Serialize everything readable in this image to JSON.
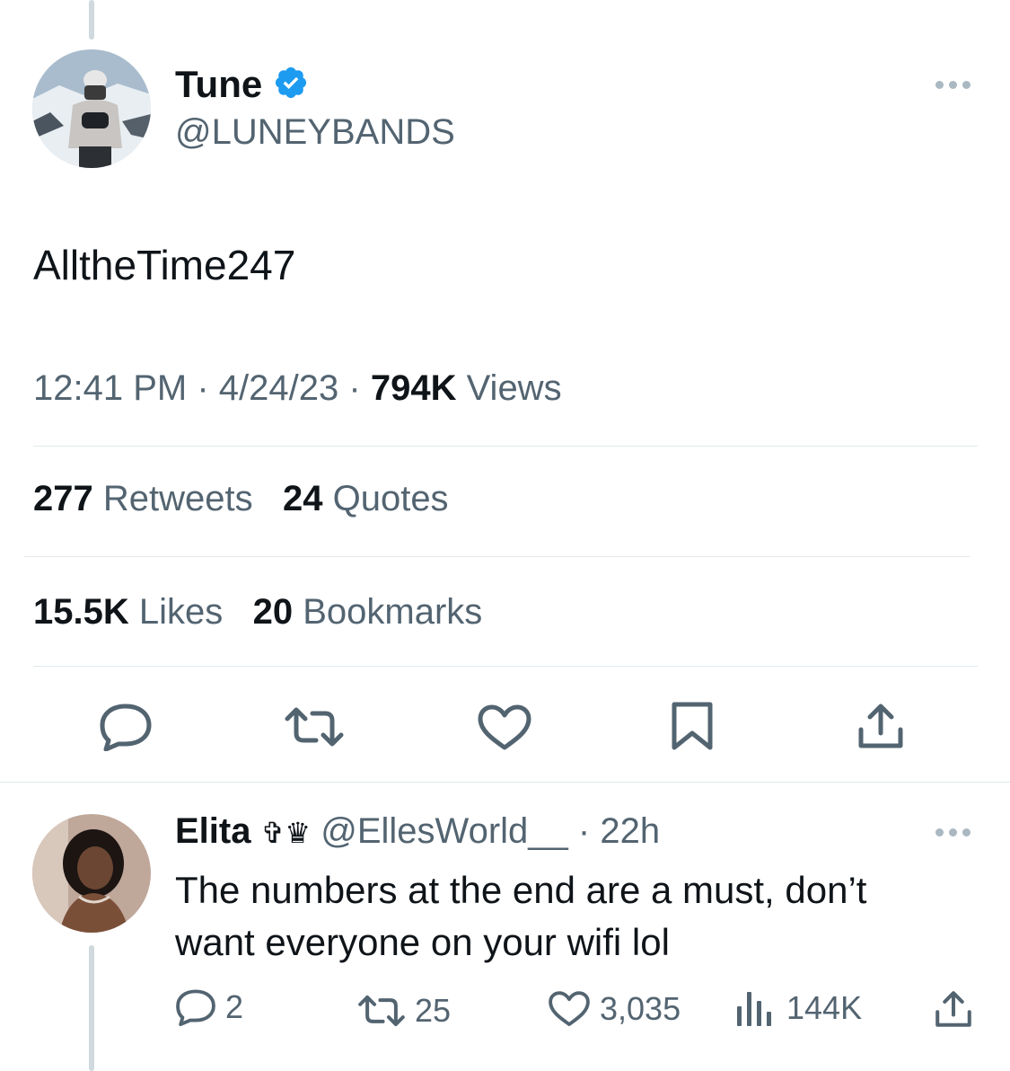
{
  "tweet": {
    "author_name": "Tune",
    "author_handle": "@LUNEYBANDS",
    "text": "AlltheTime247",
    "time": "12:41 PM",
    "date": "4/24/23",
    "views_count": "794K",
    "views_label": "Views",
    "retweets_count": "277",
    "retweets_label": "Retweets",
    "quotes_count": "24",
    "quotes_label": "Quotes",
    "likes_count": "15.5K",
    "likes_label": "Likes",
    "bookmarks_count": "20",
    "bookmarks_label": "Bookmarks",
    "separator": "·"
  },
  "reply": {
    "author_name": "Elita",
    "author_emoji": "✞♛",
    "author_handle": "@EllesWorld__",
    "separator": "·",
    "time": "22h",
    "text_line1": "The numbers at the end are a must, don’t",
    "text_line2": "want everyone on your wifi lol",
    "replies": "2",
    "retweets": "25",
    "likes": "3,035",
    "views": "144K"
  },
  "colors": {
    "verified": "#1d9bf0",
    "text_primary": "#0f1419",
    "text_secondary": "#536471",
    "divider": "#e1e8ed"
  },
  "icons": [
    "verified-badge-icon",
    "more-icon",
    "reply-icon",
    "retweet-icon",
    "like-icon",
    "bookmark-icon",
    "share-icon",
    "views-icon"
  ]
}
